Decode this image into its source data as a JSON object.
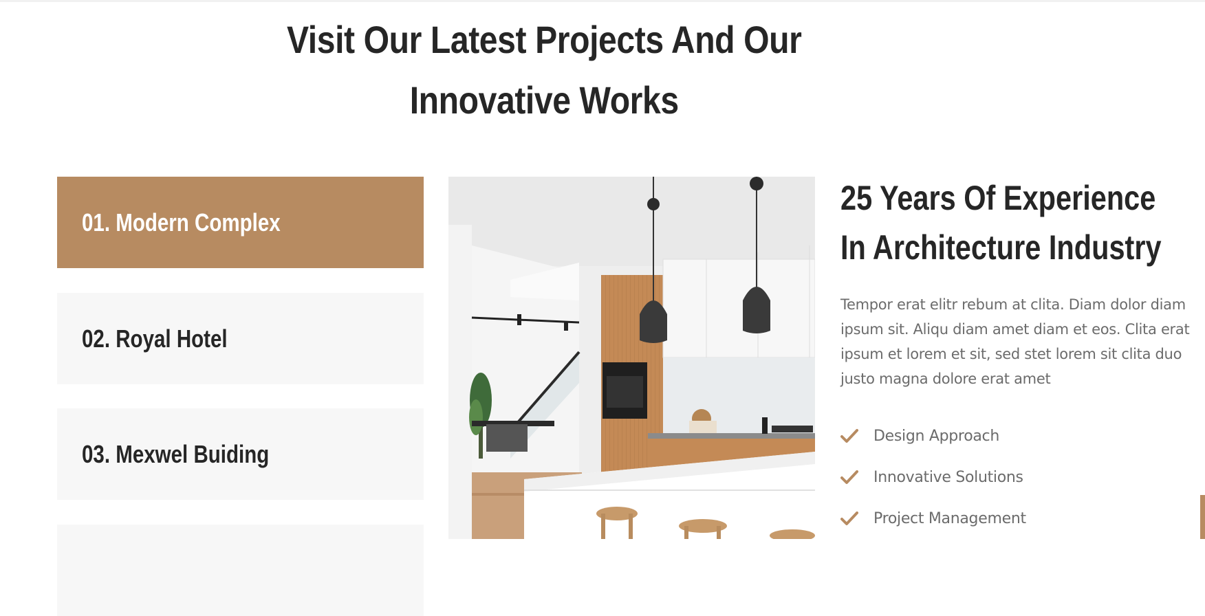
{
  "colors": {
    "accent": "#b78b61",
    "heading": "#262626",
    "body_text": "#6b6b6b",
    "tab_bg": "#f7f7f7"
  },
  "section": {
    "title_line1": "Visit Our Latest Projects And Our",
    "title_line2": "Innovative Works"
  },
  "projects": {
    "tabs": [
      {
        "label": "01. Modern Complex",
        "active": true
      },
      {
        "label": "02. Royal Hotel",
        "active": false
      },
      {
        "label": "03. Mexwel Buiding",
        "active": false
      },
      {
        "label": "",
        "active": false
      }
    ]
  },
  "detail": {
    "title_line1": "25 Years Of Experience",
    "title_line2": "In Architecture Industry",
    "description": "Tempor erat elitr rebum at clita. Diam dolor diam ipsum sit. Aliqu diam amet diam et eos. Clita erat ipsum et lorem et sit, sed stet lorem sit clita duo justo magna dolore erat amet",
    "features": [
      "Design Approach",
      "Innovative Solutions",
      "Project Management"
    ],
    "feature_icon": "check-icon"
  },
  "floating": {
    "back_to_top_icon": "arrow-up-icon"
  }
}
